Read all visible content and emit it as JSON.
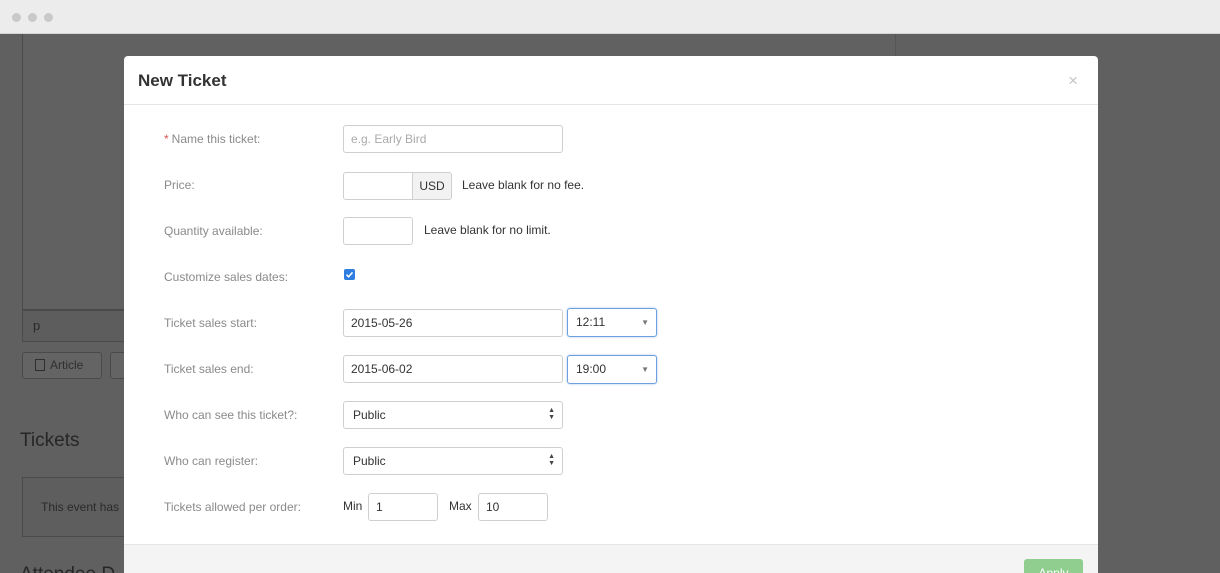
{
  "background": {
    "path_text": "p",
    "article_button": "Article",
    "tickets_heading": "Tickets",
    "event_text": "This event has",
    "attendees_heading": "Attendee D"
  },
  "modal": {
    "title": "New Ticket",
    "close": "×",
    "name": {
      "required_mark": "*",
      "label": "Name this ticket:",
      "placeholder": "e.g. Early Bird",
      "value": ""
    },
    "price": {
      "label": "Price:",
      "value": "",
      "currency": "USD",
      "hint": "Leave blank for no fee."
    },
    "quantity": {
      "label": "Quantity available:",
      "value": "",
      "hint": "Leave blank for no limit."
    },
    "customize": {
      "label": "Customize sales dates:",
      "checked": true
    },
    "sales_start": {
      "label": "Ticket sales start:",
      "date": "2015-05-26",
      "time": "12:11"
    },
    "sales_end": {
      "label": "Ticket sales end:",
      "date": "2015-06-02",
      "time": "19:00"
    },
    "visibility": {
      "label": "Who can see this ticket?:",
      "value": "Public"
    },
    "registration": {
      "label": "Who can register:",
      "value": "Public"
    },
    "per_order": {
      "label": "Tickets allowed per order:",
      "min_label": "Min",
      "min_value": "1",
      "max_label": "Max",
      "max_value": "10"
    },
    "apply_button": "Apply"
  },
  "colors": {
    "accent": "#2f7de1",
    "apply": "#8fce8f",
    "required": "#d9534f"
  }
}
